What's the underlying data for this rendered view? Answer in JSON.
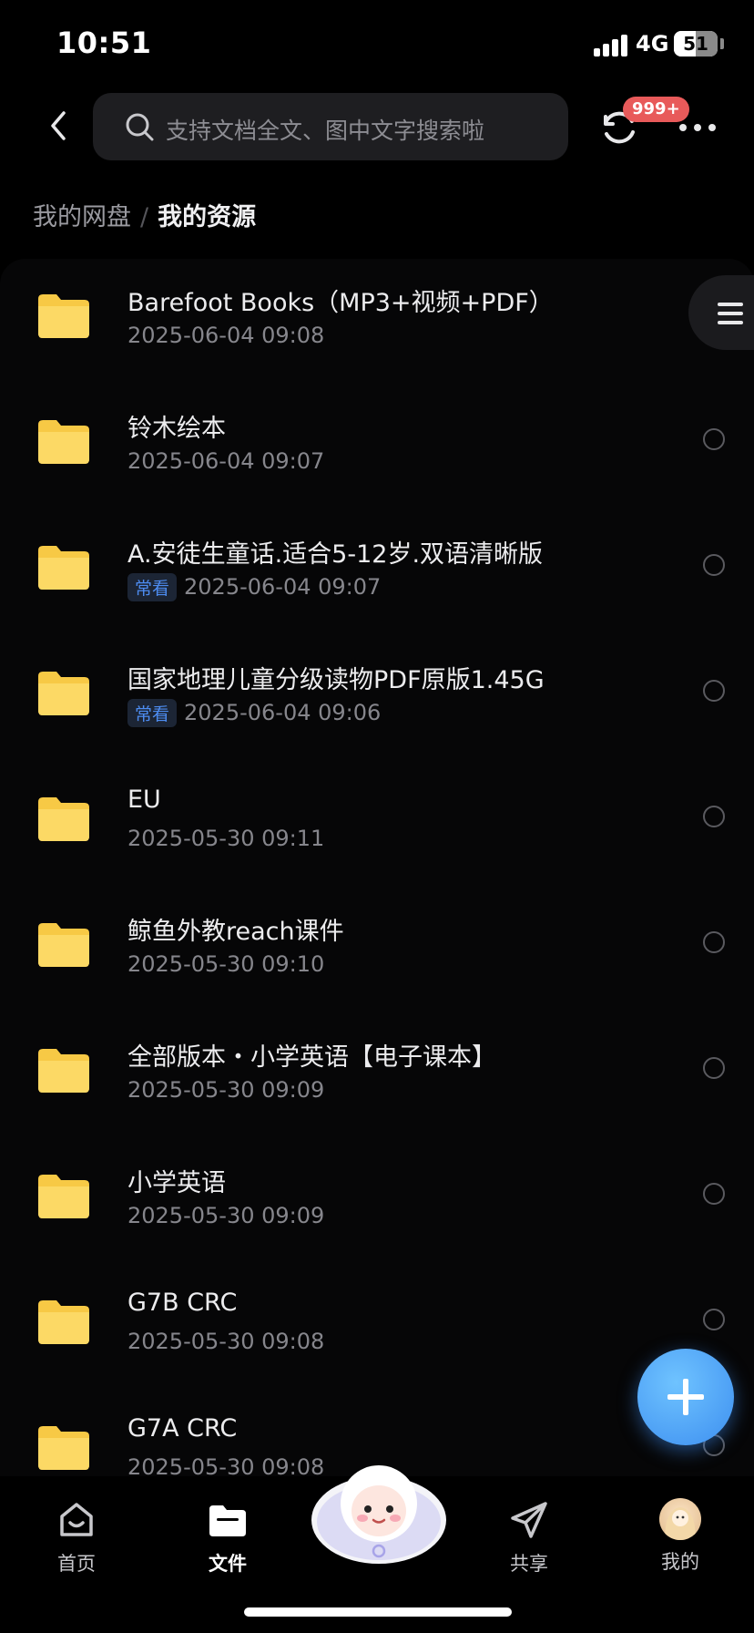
{
  "status_bar": {
    "time": "10:51",
    "network": "4G",
    "battery": "51",
    "battery_level": 0.51
  },
  "header": {
    "search_placeholder": "支持文档全文、图中文字搜索啦",
    "sync_badge": "999+"
  },
  "breadcrumb": {
    "root": "我的网盘",
    "separator": "/",
    "current": "我的资源"
  },
  "files": [
    {
      "name": "Barefoot Books（MP3+视频+PDF）",
      "date": "2025-06-04 09:08",
      "tag": ""
    },
    {
      "name": "铃木绘本",
      "date": "2025-06-04 09:07",
      "tag": ""
    },
    {
      "name": "A.安徒生童话.适合5-12岁.双语清晰版",
      "date": "2025-06-04 09:07",
      "tag": "常看"
    },
    {
      "name": "国家地理儿童分级读物PDF原版1.45G",
      "date": "2025-06-04 09:06",
      "tag": "常看"
    },
    {
      "name": "EU",
      "date": "2025-05-30 09:11",
      "tag": ""
    },
    {
      "name": "鲸鱼外教reach课件",
      "date": "2025-05-30 09:10",
      "tag": ""
    },
    {
      "name": "全部版本・小学英语【电子课本】",
      "date": "2025-05-30 09:09",
      "tag": ""
    },
    {
      "name": "小学英语",
      "date": "2025-05-30 09:09",
      "tag": ""
    },
    {
      "name": "G7B CRC",
      "date": "2025-05-30 09:08",
      "tag": ""
    },
    {
      "name": "G7A CRC",
      "date": "2025-05-30 09:08",
      "tag": ""
    }
  ],
  "tabbar": {
    "home": "首页",
    "files": "文件",
    "share": "共享",
    "mine": "我的"
  },
  "colors": {
    "accent": "#3d8ff0",
    "badge": "#e85a5a",
    "folder": "#f7c945",
    "tag_text": "#4d8cf0"
  },
  "icons": {
    "back": "chevron-left-icon",
    "search": "search-icon",
    "sync": "sync-icon",
    "more": "more-dots-icon",
    "fab": "plus-icon"
  }
}
